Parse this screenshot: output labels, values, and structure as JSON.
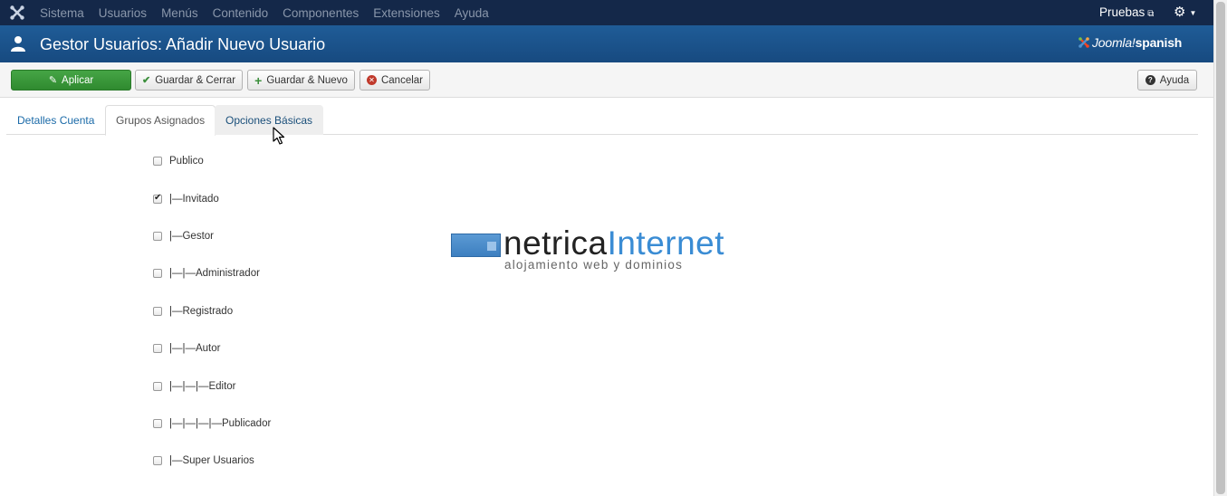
{
  "topbar": {
    "menu": [
      "Sistema",
      "Usuarios",
      "Menús",
      "Contenido",
      "Componentes",
      "Extensiones",
      "Ayuda"
    ],
    "site_link": "Pruebas"
  },
  "header": {
    "title": "Gestor Usuarios: Añadir Nuevo Usuario",
    "brand_a": "Joomla!",
    "brand_b": "spanish"
  },
  "toolbar": {
    "apply": "Aplicar",
    "save_close": "Guardar & Cerrar",
    "save_new": "Guardar & Nuevo",
    "cancel": "Cancelar",
    "help": "Ayuda"
  },
  "tabs": [
    {
      "label": "Detalles Cuenta",
      "state": "normal"
    },
    {
      "label": "Grupos Asignados",
      "state": "active"
    },
    {
      "label": "Opciones Básicas",
      "state": "hover"
    }
  ],
  "groups": [
    {
      "label": "Publico",
      "checked": false
    },
    {
      "label": "|—Invitado",
      "checked": true
    },
    {
      "label": "|—Gestor",
      "checked": false
    },
    {
      "label": "|—|—Administrador",
      "checked": false
    },
    {
      "label": "|—Registrado",
      "checked": false
    },
    {
      "label": "|—|—Autor",
      "checked": false
    },
    {
      "label": "|—|—|—Editor",
      "checked": false
    },
    {
      "label": "|—|—|—|—Publicador",
      "checked": false
    },
    {
      "label": "|—Super Usuarios",
      "checked": false
    }
  ],
  "watermark": {
    "name_a": "netrica",
    "name_b": "Internet",
    "tagline": "alojamiento web y dominios"
  },
  "colors": {
    "topbar": "#142849",
    "header": "#1f5c97",
    "apply_green": "#46a546",
    "link_blue": "#1a6aa8",
    "watermark_blue": "#3a8cd4"
  }
}
